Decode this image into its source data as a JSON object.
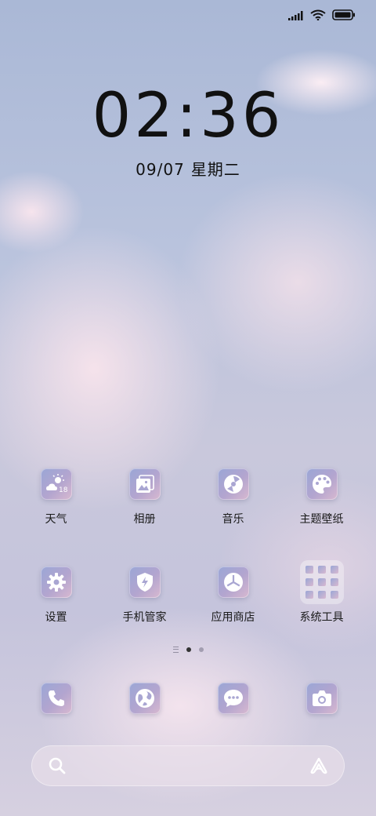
{
  "status_bar": {
    "icons": [
      "signal-icon",
      "wifi-icon",
      "battery-icon"
    ]
  },
  "lockscreen": {
    "time_hours": "02",
    "time_separator": ":",
    "time_minutes": "36",
    "date": "09/07",
    "weekday": "星期二"
  },
  "home": {
    "row1": [
      {
        "label": "天气",
        "icon": "weather-icon",
        "temperature": "18°"
      },
      {
        "label": "相册",
        "icon": "gallery-icon"
      },
      {
        "label": "音乐",
        "icon": "music-icon"
      },
      {
        "label": "主题壁纸",
        "icon": "palette-icon"
      }
    ],
    "row2": [
      {
        "label": "设置",
        "icon": "gear-icon"
      },
      {
        "label": "手机管家",
        "icon": "shield-icon"
      },
      {
        "label": "应用商店",
        "icon": "app-store-icon"
      },
      {
        "label": "系统工具",
        "icon": "folder-icon"
      }
    ],
    "dock": [
      {
        "icon": "phone-icon"
      },
      {
        "icon": "browser-icon"
      },
      {
        "icon": "messages-icon"
      },
      {
        "icon": "camera-icon"
      }
    ],
    "page_indicator": {
      "pages": 3,
      "active": 2
    }
  },
  "search_bar": {
    "left_icon": "search-icon",
    "right_icon": "assistant-icon"
  },
  "colors": {
    "icon_gradient_start": "#9aa6d6",
    "icon_gradient_end": "#d8b9d0",
    "text": "#1a1a1a"
  }
}
